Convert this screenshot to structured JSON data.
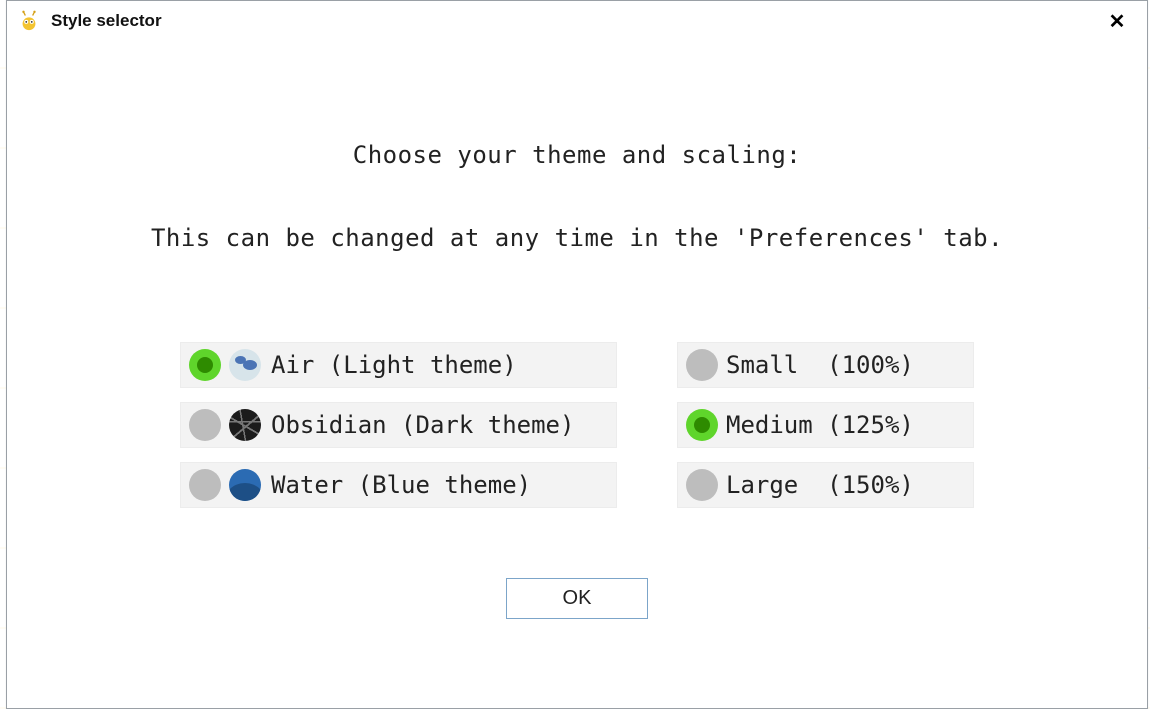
{
  "window": {
    "title": "Style selector",
    "close_glyph": "✕"
  },
  "prompt": {
    "line1": "Choose your theme and scaling:",
    "line2": "This can be changed at any time in the 'Preferences' tab."
  },
  "themes": [
    {
      "id": "air",
      "label": "Air (Light theme)",
      "selected": true
    },
    {
      "id": "obsidian",
      "label": "Obsidian (Dark theme)",
      "selected": false
    },
    {
      "id": "water",
      "label": "Water (Blue theme)",
      "selected": false
    }
  ],
  "scaling": [
    {
      "id": "small",
      "label": "Small  (100%)",
      "selected": false
    },
    {
      "id": "medium",
      "label": "Medium (125%)",
      "selected": true
    },
    {
      "id": "large",
      "label": "Large  (150%)",
      "selected": false
    }
  ],
  "buttons": {
    "ok": "OK"
  }
}
